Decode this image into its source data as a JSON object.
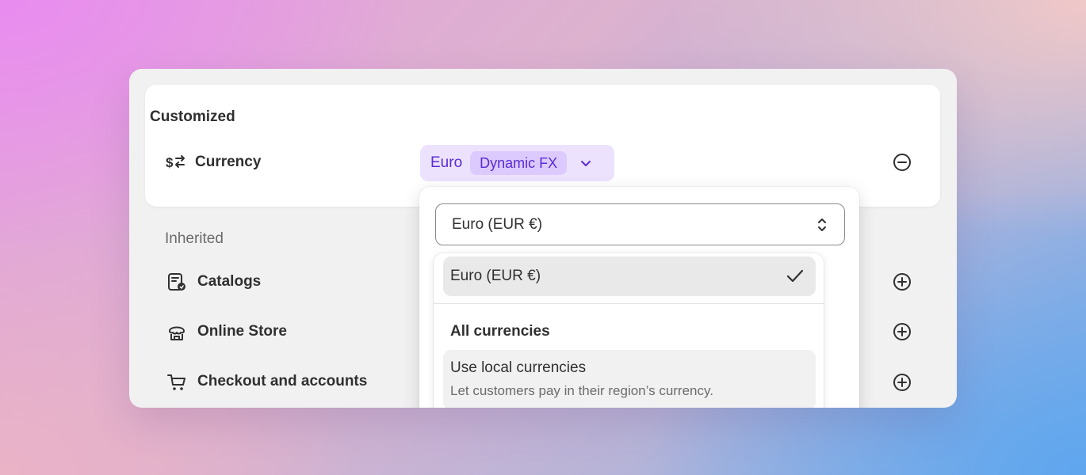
{
  "customized": {
    "title": "Customized",
    "currency_row": {
      "icon": "currency-exchange-icon",
      "label": "Currency",
      "value": "Euro",
      "badge": "Dynamic FX",
      "action_icon": "minus-circle-icon"
    }
  },
  "inherited": {
    "title": "Inherited",
    "rows": [
      {
        "icon": "catalog-icon",
        "label": "Catalogs",
        "action_icon": "plus-circle-icon"
      },
      {
        "icon": "store-icon",
        "label": "Online Store",
        "action_icon": "plus-circle-icon"
      },
      {
        "icon": "cart-icon",
        "label": "Checkout and accounts",
        "action_icon": "plus-circle-icon"
      }
    ]
  },
  "dropdown": {
    "select_value": "Euro (EUR €)",
    "options": {
      "selected": {
        "label": "Euro (EUR €)",
        "checked": true
      },
      "group_title": "All currencies",
      "local": {
        "label": "Use local currencies",
        "description": "Let customers pay in their region’s currency."
      }
    }
  },
  "colors": {
    "accent": "#5b2bd6",
    "pill_bg": "#ece2fe",
    "badge_bg": "#dccaff",
    "text": "#303030"
  }
}
